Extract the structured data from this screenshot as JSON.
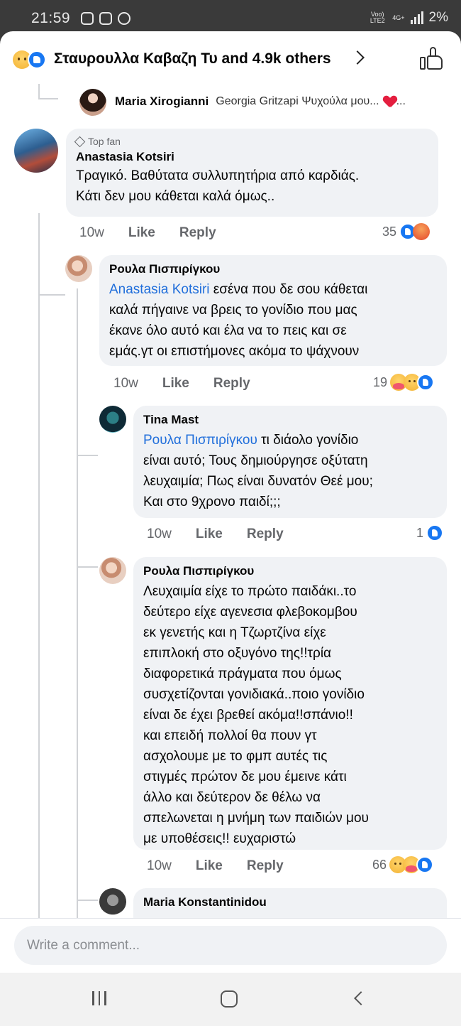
{
  "status": {
    "time": "21:59",
    "network": "Voo) LTE2",
    "network_tag": "4G+",
    "battery": "2%"
  },
  "header": {
    "title": "Σταυρουλλα Καβαζη Τυ and 4.9k others"
  },
  "reply_preview": {
    "name": "Maria Xirogianni",
    "text": "Georgia Gritzapi Ψυχούλα μου...",
    "trail": "..."
  },
  "comments": [
    {
      "badge": "Top fan",
      "name": "Anastasia Kotsiri",
      "lines": [
        "Τραγικό. Βαθύτατα συλλυπητήρια από καρδιάς.",
        "Κάτι δεν μου κάθεται καλά όμως.."
      ],
      "time": "10w",
      "like": "Like",
      "reply": "Reply",
      "count": "35"
    },
    {
      "name": "Ρουλα Πισπιρίγκου",
      "mention": "Anastasia Kotsiri",
      "lines": [
        " εσένα που δε σου κάθεται",
        "καλά πήγαινε να βρεις το γονίδιο που μας",
        "έκανε όλο αυτό και έλα να το πεις και σε",
        "εμάς.γτ οι επιστήμονες ακόμα το ψάχνουν"
      ],
      "time": "10w",
      "like": "Like",
      "reply": "Reply",
      "count": "19"
    },
    {
      "name": "Tina Mast",
      "mention": "Ρουλα Πισπιρίγκου",
      "lines": [
        " τι διάολο γονίδιο",
        "είναι αυτό; Τους δημιούργησε οξύτατη",
        "λευχαιμία; Πως είναι δυνατόν Θεέ μου;",
        "Και στο 9χρονο παιδί;;;"
      ],
      "time": "10w",
      "like": "Like",
      "reply": "Reply",
      "count": "1"
    },
    {
      "name": "Ρουλα Πισπιρίγκου",
      "lines": [
        "Λευχαιμία είχε το πρώτο παιδάκι..το",
        "δεύτερο είχε αγενεσια φλεβοκομβου",
        "εκ γενετής και η Τζωρτζίνα είχε",
        "επιπλοκή στο οξυγόνο της!!τρία",
        "διαφορετικά πράγματα που όμως",
        "συσχετίζονται γονιδιακά..ποιο γονίδιο",
        "είναι δε έχει βρεθεί ακόμα!!σπάνιο!!",
        "και επειδή πολλοί θα πουν γτ",
        "ασχολουμε με το φμπ αυτές τις",
        "στιγμές πρώτον δε μου έμεινε κάτι",
        "άλλο και δεύτερον δε θέλω να",
        "σπελωνεται η μνήμη των παιδιών μου",
        "με υποθέσεις!! ευχαριστώ"
      ],
      "time": "10w",
      "like": "Like",
      "reply": "Reply",
      "count": "66"
    },
    {
      "name": "Maria Konstantinidou"
    }
  ],
  "composer": {
    "placeholder": "Write a comment..."
  },
  "icons": {
    "header_reactions": [
      "sad-emoji",
      "like-emoji"
    ],
    "header_action": "thumbs-up-icon",
    "c1_reactions": [
      "like-emoji",
      "angry-emoji"
    ],
    "c2_reactions": [
      "care-emoji",
      "sad-emoji",
      "like-emoji"
    ],
    "c3_reactions": [
      "like-emoji"
    ],
    "c4_reactions": [
      "sad-emoji",
      "care-emoji",
      "like-emoji"
    ]
  },
  "colors": {
    "like_blue": "#1877f2",
    "mention": "#216fdb",
    "bubble": "#f0f2f5",
    "meta": "#65676b"
  }
}
